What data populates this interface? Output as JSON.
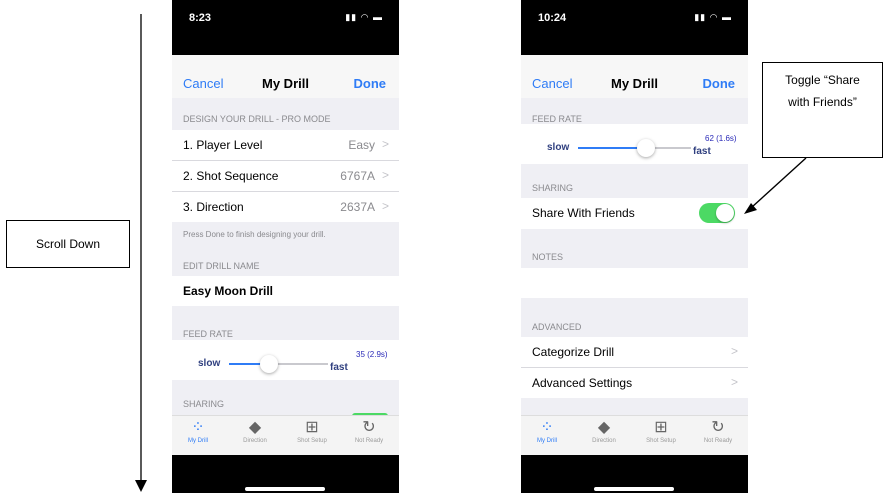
{
  "annotations": {
    "scroll_label": "Scroll Down",
    "toggle_callout_line1": "Toggle “Share",
    "toggle_callout_line2": "with Friends”"
  },
  "left_phone": {
    "time": "8:23",
    "nav": {
      "cancel": "Cancel",
      "title": "My Drill",
      "done": "Done"
    },
    "design_header": "DESIGN YOUR DRILL - PRO MODE",
    "rows": [
      {
        "label": "1. Player Level",
        "value": "Easy"
      },
      {
        "label": "2. Shot Sequence",
        "value": "6767A"
      },
      {
        "label": "3. Direction",
        "value": "2637A"
      }
    ],
    "done_note": "Press Done to finish designing your drill.",
    "edit_name_header": "EDIT DRILL NAME",
    "drill_name": "Easy Moon Drill",
    "feed_rate_header": "FEED RATE",
    "slider": {
      "slow": "slow",
      "fast": "fast",
      "value": "35 (2.9s)"
    },
    "sharing_header": "SHARING"
  },
  "right_phone": {
    "time": "10:24",
    "nav": {
      "cancel": "Cancel",
      "title": "My Drill",
      "done": "Done"
    },
    "feed_rate_header": "FEED RATE",
    "slider": {
      "slow": "slow",
      "fast": "fast",
      "value": "62 (1.6s)"
    },
    "sharing_header": "SHARING",
    "share_label": "Share With Friends",
    "share_on": true,
    "notes_header": "NOTES",
    "advanced_header": "ADVANCED",
    "advanced_rows": [
      {
        "label": "Categorize Drill"
      },
      {
        "label": "Advanced Settings"
      }
    ]
  },
  "tabs": [
    {
      "label": "My Drill",
      "icon": "drill-pattern-icon"
    },
    {
      "label": "Direction",
      "icon": "direction-sign-icon"
    },
    {
      "label": "Shot Setup",
      "icon": "sliders-icon"
    },
    {
      "label": "Not Ready",
      "icon": "refresh-icon"
    }
  ],
  "colors": {
    "accent": "#2f7cf6",
    "toggle_on": "#4cd964",
    "tab_active": "#2f7cf6"
  }
}
